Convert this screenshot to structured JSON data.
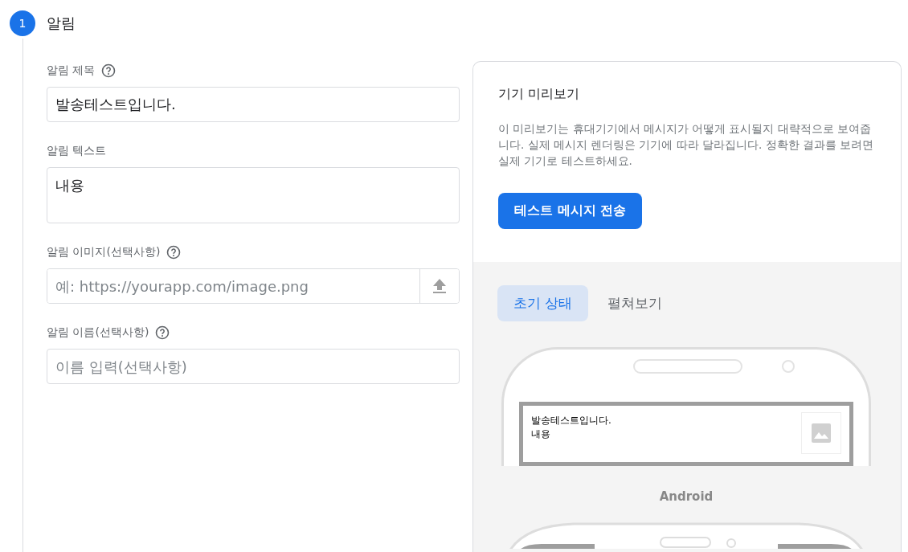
{
  "step": {
    "number": "1",
    "title": "알림"
  },
  "fields": [
    {
      "kind": "text",
      "label": "알림 제목",
      "help": true,
      "value": "발송테스트입니다."
    },
    {
      "kind": "textarea",
      "label": "알림 텍스트",
      "help": false,
      "value": "내용"
    },
    {
      "kind": "upload",
      "label": "알림 이미지(선택사항)",
      "help": true,
      "placeholder": "예: https://yourapp.com/image.png"
    },
    {
      "kind": "text",
      "label": "알림 이름(선택사항)",
      "help": true,
      "placeholder": "이름 입력(선택사항)"
    }
  ],
  "preview": {
    "title": "기기 미리보기",
    "description": "이 미리보기는 휴대기기에서 메시지가 어떻게 표시될지 대략적으로 보여줍니다. 실제 메시지 렌더링은 기기에 따라 달라집니다. 정확한 결과를 보려면 실제 기기로 테스트하세요.",
    "button": "테스트 메시지 전송",
    "tabs": [
      {
        "label": "초기 상태",
        "selected": true
      },
      {
        "label": "펼쳐보기",
        "selected": false
      }
    ],
    "notification": {
      "title": "발송테스트입니다.",
      "body": "내용"
    },
    "platform": "Android"
  }
}
